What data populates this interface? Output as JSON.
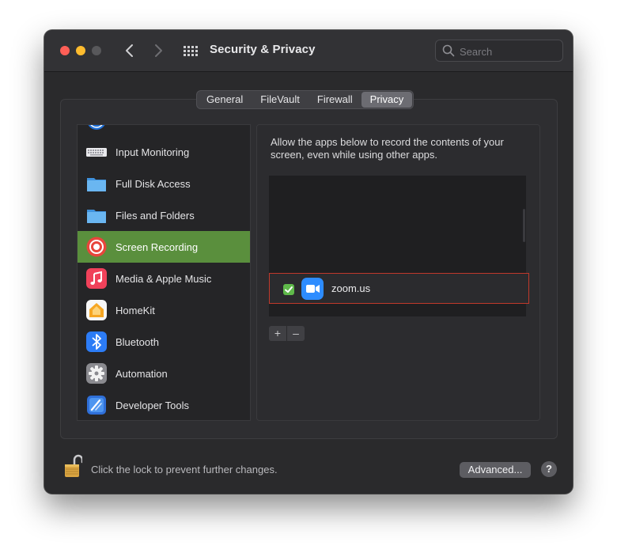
{
  "window": {
    "title": "Security & Privacy",
    "search_placeholder": "Search"
  },
  "tabs": [
    {
      "label": "General"
    },
    {
      "label": "FileVault"
    },
    {
      "label": "Firewall"
    },
    {
      "label": "Privacy",
      "selected": true
    }
  ],
  "sidebar": {
    "items": [
      {
        "label": "",
        "icon": "accessibility-icon"
      },
      {
        "label": "Input Monitoring",
        "icon": "keyboard-icon"
      },
      {
        "label": "Full Disk Access",
        "icon": "folder-icon"
      },
      {
        "label": "Files and Folders",
        "icon": "folder-icon"
      },
      {
        "label": "Screen Recording",
        "icon": "screen-recording-icon",
        "selected": true
      },
      {
        "label": "Media & Apple Music",
        "icon": "music-icon"
      },
      {
        "label": "HomeKit",
        "icon": "homekit-icon"
      },
      {
        "label": "Bluetooth",
        "icon": "bluetooth-icon"
      },
      {
        "label": "Automation",
        "icon": "gear-icon"
      },
      {
        "label": "Developer Tools",
        "icon": "developer-tools-icon"
      }
    ]
  },
  "pane": {
    "description": "Allow the apps below to record the contents of your screen, even while using other apps.",
    "apps": [
      {
        "name": "zoom.us",
        "checked": true,
        "icon": "zoom-video-icon"
      }
    ],
    "add_label": "+",
    "remove_label": "–"
  },
  "footer": {
    "lock_text": "Click the lock to prevent further changes.",
    "advanced_label": "Advanced...",
    "help_label": "?"
  },
  "colors": {
    "selected_row": "#5a8f3d",
    "highlight_border": "#c0392b",
    "checkbox": "#5fb94a",
    "zoom_blue": "#2d8cff"
  }
}
